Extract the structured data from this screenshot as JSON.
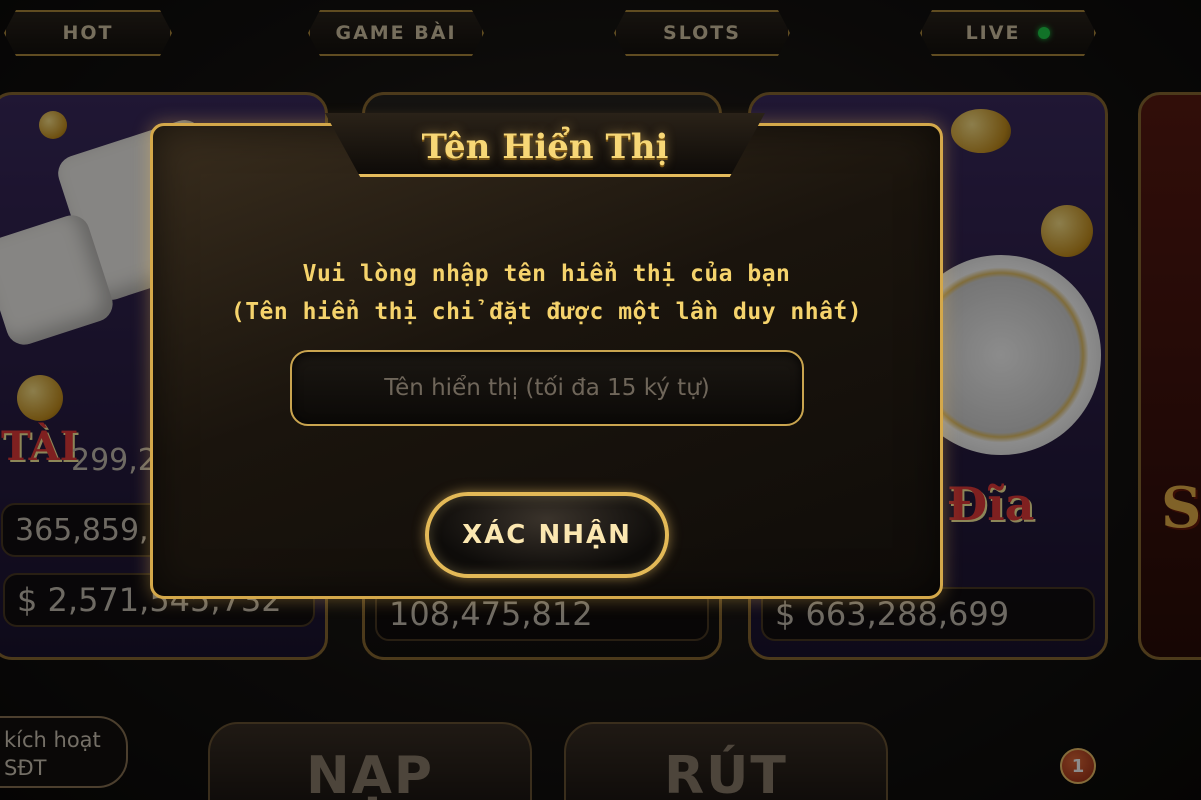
{
  "nav_tabs": [
    {
      "label": "HOT"
    },
    {
      "label": "GAME BÀI"
    },
    {
      "label": "SLOTS"
    },
    {
      "label": "LIVE"
    }
  ],
  "game_cards": [
    {
      "label": "TÀI",
      "value_top": "299,2",
      "value_mid": "365,859,0",
      "jackpot": "$ 2,571,545,732"
    },
    {
      "jackpot": "108,475,812"
    },
    {
      "label": "Đĩa",
      "jackpot": "$ 663,288,699"
    },
    {
      "label": "S"
    }
  ],
  "bottom_bar": {
    "activate_label_line1": "kích hoạt",
    "activate_label_line2": "SĐT",
    "deposit_label": "NẠP",
    "withdraw_label": "RÚT",
    "notification_count": "1"
  },
  "dialog": {
    "title": "Tên Hiển Thị",
    "message_line1": "Vui lòng nhập tên hiển thị của bạn",
    "message_line2": "(Tên hiển thị chỉ đặt được một lần duy nhất)",
    "input": {
      "value": "",
      "placeholder": "Tên hiển thị (tối đa 15 ký tự)"
    },
    "confirm_label": "XÁC NHẬN"
  },
  "colors": {
    "accent_gold": "#e3b957",
    "title_text": "#f7d776",
    "live_indicator": "#1fd04a"
  }
}
